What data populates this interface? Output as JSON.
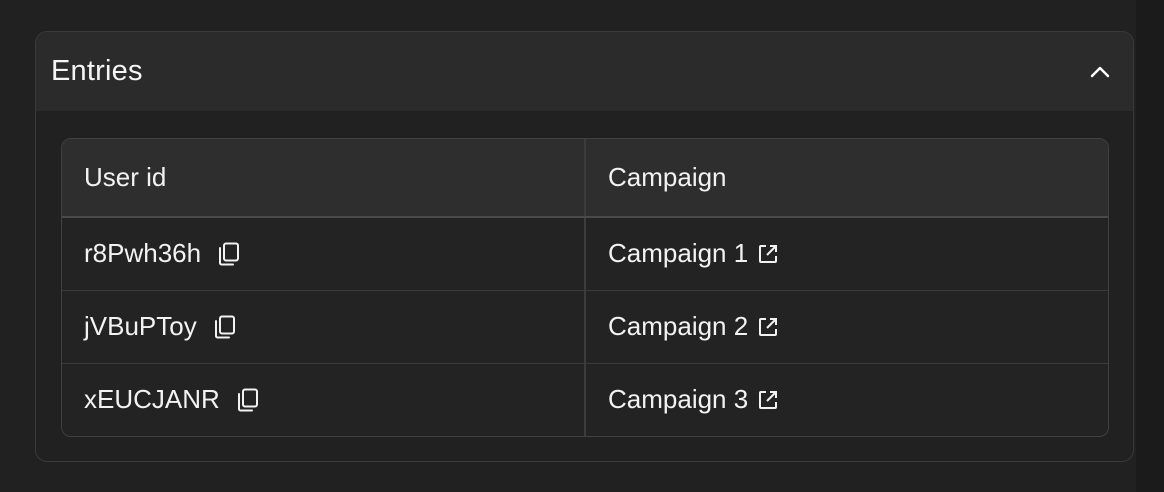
{
  "panel": {
    "title": "Entries",
    "collapse_icon": "chevron-up-icon"
  },
  "table": {
    "columns": [
      "User id",
      "Campaign"
    ],
    "rows": [
      {
        "user_id": "r8Pwh36h",
        "campaign": "Campaign 1"
      },
      {
        "user_id": "jVBuPToy",
        "campaign": "Campaign 2"
      },
      {
        "user_id": "xEUCJANR",
        "campaign": "Campaign 3"
      }
    ],
    "user_icon": "copy-icon",
    "campaign_icon": "external-link-icon"
  },
  "colors": {
    "background": "#212121",
    "header_bg": "#2b2b2b",
    "table_header_bg": "#2e2e2e",
    "text": "#f2f2f2",
    "border": "#414141"
  }
}
